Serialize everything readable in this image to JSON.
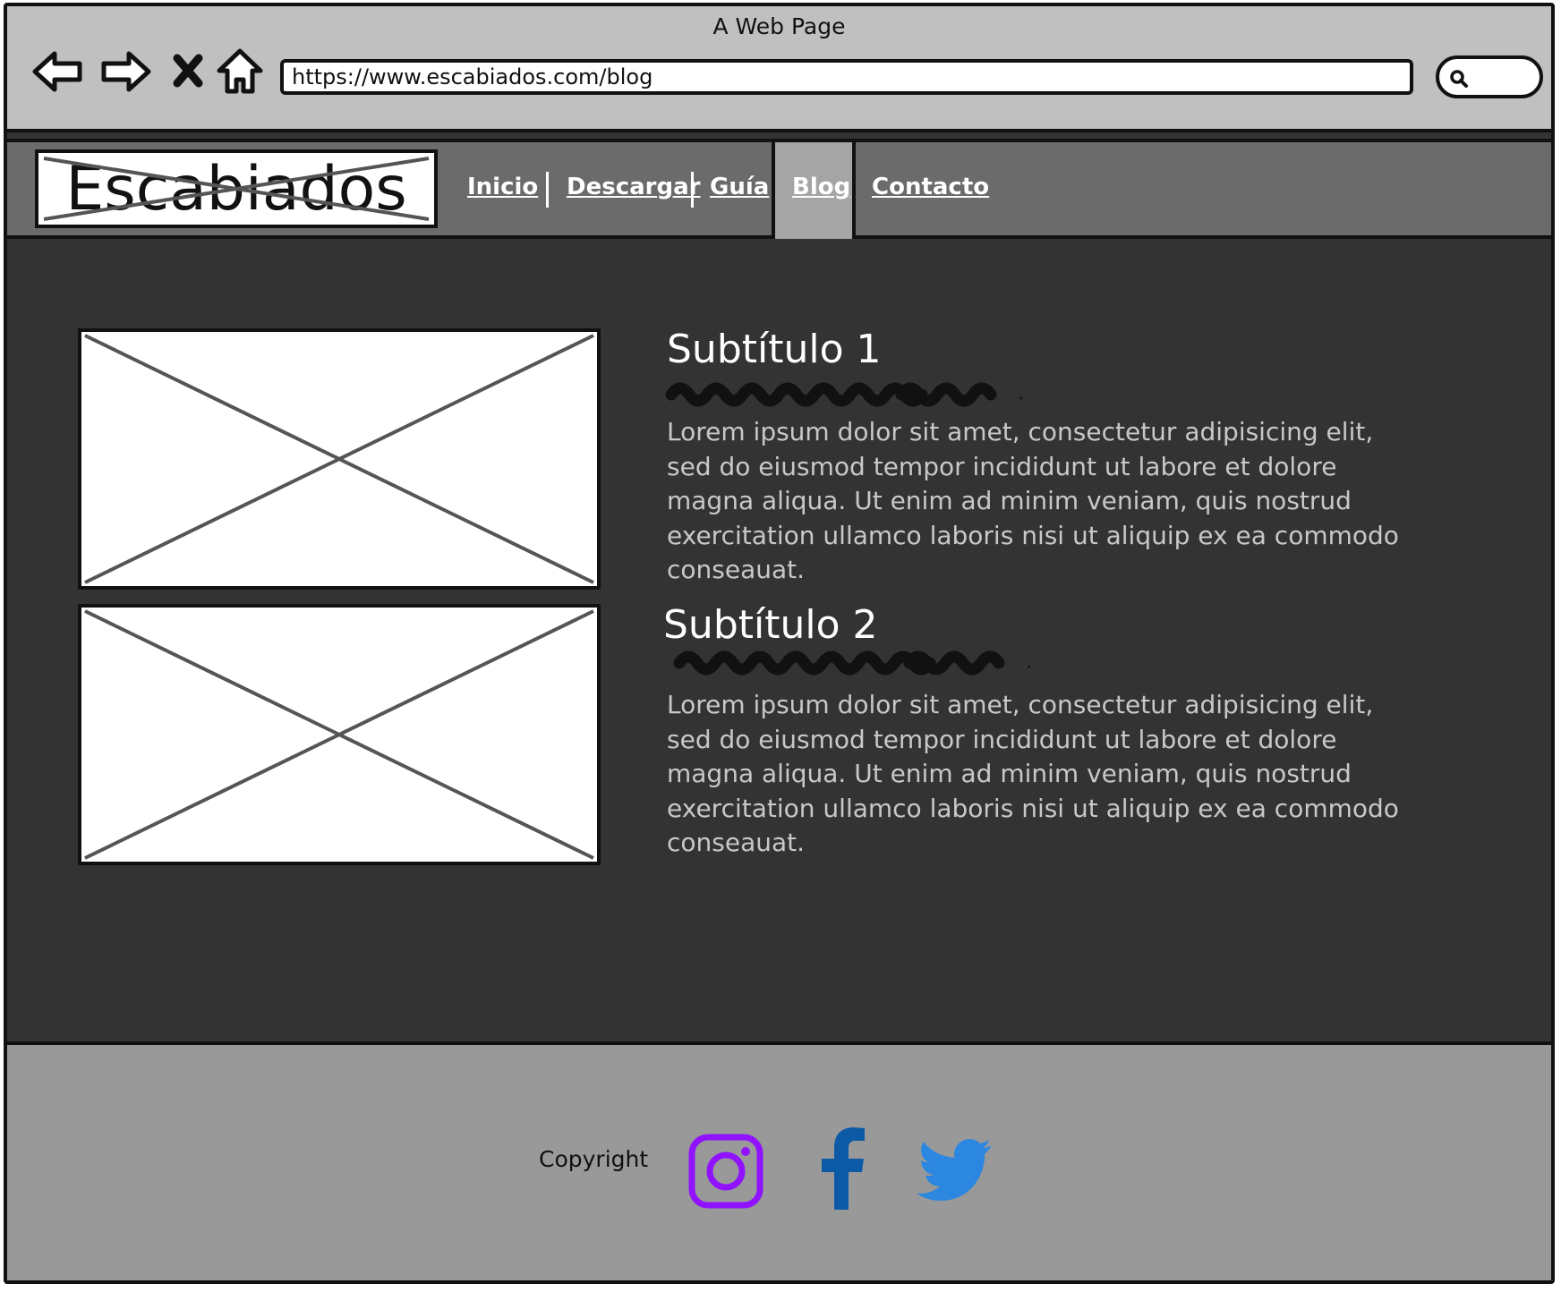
{
  "browser": {
    "window_title": "A Web Page",
    "url": "https://www.escabiados.com/blog"
  },
  "site": {
    "logo_text": "Escabiados",
    "menu": [
      {
        "label": "Inicio"
      },
      {
        "label": "Descargar"
      },
      {
        "label": "Guía"
      },
      {
        "label": "Blog",
        "active": true
      },
      {
        "label": "Contacto"
      }
    ]
  },
  "posts": [
    {
      "title": "Subtítulo 1",
      "body": "Lorem ipsum dolor sit amet, consectetur adipisicing elit, sed do eiusmod tempor incididunt ut labore et dolore magna aliqua. Ut enim ad minim veniam, quis nostrud exercitation ullamco laboris nisi ut aliquip ex ea commodo conseauat."
    },
    {
      "title": "Subtítulo 2",
      "body": "Lorem ipsum dolor sit amet, consectetur adipisicing elit, sed do eiusmod tempor incididunt ut labore et dolore magna aliqua. Ut enim ad minim veniam, quis nostrud exercitation ullamco laboris nisi ut aliquip ex ea commodo conseauat."
    }
  ],
  "footer": {
    "copyright": "Copyright",
    "social": [
      {
        "icon": "instagram-icon",
        "color": "#9012fe"
      },
      {
        "icon": "facebook-icon",
        "color": "#0c5aa6"
      },
      {
        "icon": "twitter-icon",
        "color": "#2b87e0"
      }
    ]
  },
  "colors": {
    "chrome": "#c0c0c0",
    "header": "#6b6b6b",
    "content_bg": "#333333",
    "footer": "#999999",
    "active_tab": "#a5a5a5"
  }
}
